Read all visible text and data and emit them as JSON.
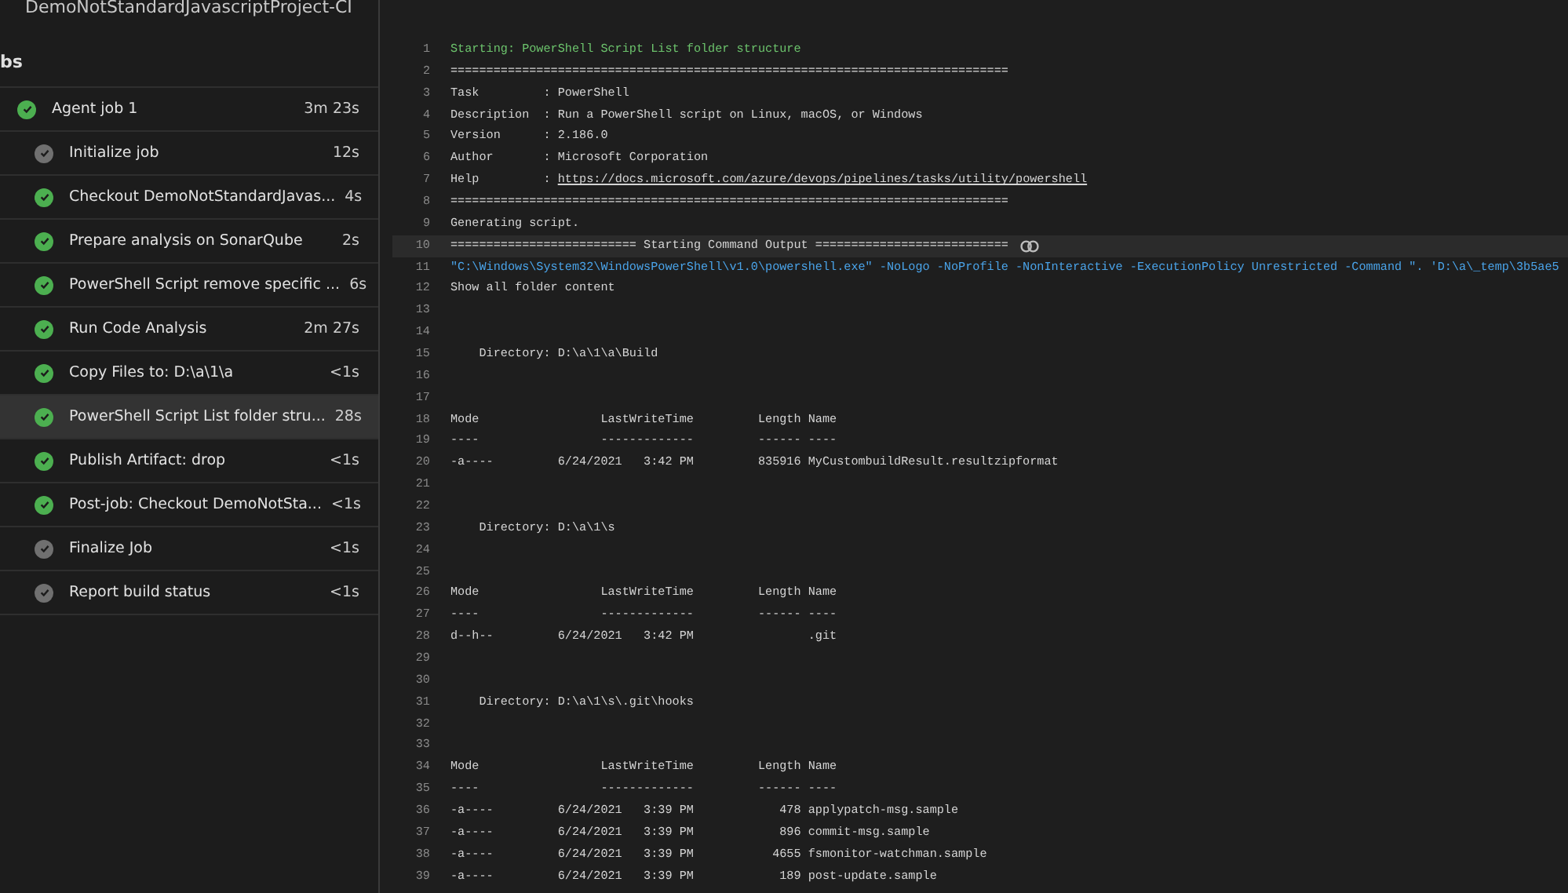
{
  "pipeline_title": "DemoNotStandardJavascriptProject-CI",
  "jobs_heading": "bs",
  "jobs": [
    {
      "label": "Agent job 1",
      "duration": "3m 23s",
      "color": "#4caf50",
      "selected": false,
      "children": [
        {
          "label": "Initialize job",
          "duration": "12s",
          "color": "#707070",
          "selected": false
        },
        {
          "label": "Checkout DemoNotStandardJavas...",
          "duration": "4s",
          "color": "#4caf50",
          "selected": false
        },
        {
          "label": "Prepare analysis on SonarQube",
          "duration": "2s",
          "color": "#4caf50",
          "selected": false
        },
        {
          "label": "PowerShell Script remove specific ...",
          "duration": "6s",
          "color": "#4caf50",
          "selected": false
        },
        {
          "label": "Run Code Analysis",
          "duration": "2m 27s",
          "color": "#4caf50",
          "selected": false
        },
        {
          "label": "Copy Files to: D:\\a\\1\\a",
          "duration": "<1s",
          "color": "#4caf50",
          "selected": false
        },
        {
          "label": "PowerShell Script List folder stru...",
          "duration": "28s",
          "color": "#4caf50",
          "selected": true
        },
        {
          "label": "Publish Artifact: drop",
          "duration": "<1s",
          "color": "#4caf50",
          "selected": false
        },
        {
          "label": "Post-job: Checkout DemoNotSta...",
          "duration": "<1s",
          "color": "#4caf50",
          "selected": false
        },
        {
          "label": "Finalize Job",
          "duration": "<1s",
          "color": "#707070",
          "selected": false
        },
        {
          "label": "Report build status",
          "duration": "<1s",
          "color": "#707070",
          "selected": false
        }
      ]
    }
  ],
  "log_lines": [
    {
      "number": "1",
      "kind": "section",
      "text": "Starting: PowerShell Script List folder structure"
    },
    {
      "number": "2",
      "kind": "plain",
      "text": "=============================================================================="
    },
    {
      "number": "3",
      "kind": "plain",
      "text": "Task         : PowerShell"
    },
    {
      "number": "4",
      "kind": "plain",
      "text": "Description  : Run a PowerShell script on Linux, macOS, or Windows"
    },
    {
      "number": "5",
      "kind": "plain",
      "text": "Version      : 2.186.0"
    },
    {
      "number": "6",
      "kind": "plain",
      "text": "Author       : Microsoft Corporation"
    },
    {
      "number": "7",
      "kind": "link",
      "text": "Help         : ",
      "link": "https://docs.microsoft.com/azure/devops/pipelines/tasks/utility/powershell"
    },
    {
      "number": "8",
      "kind": "plain",
      "text": "=============================================================================="
    },
    {
      "number": "9",
      "kind": "plain",
      "text": "Generating script."
    },
    {
      "number": "10",
      "kind": "marker",
      "text": "========================== Starting Command Output ==========================="
    },
    {
      "number": "11",
      "kind": "command",
      "text": "\"C:\\Windows\\System32\\WindowsPowerShell\\v1.0\\powershell.exe\" -NoLogo -NoProfile -NonInteractive -ExecutionPolicy Unrestricted -Command \". 'D:\\a\\_temp\\3b5ae5"
    },
    {
      "number": "12",
      "kind": "plain",
      "text": "Show all folder content"
    },
    {
      "number": "13",
      "kind": "plain"
    },
    {
      "number": "14",
      "kind": "plain"
    },
    {
      "number": "15",
      "kind": "plain",
      "text": "    Directory: D:\\a\\1\\a\\Build"
    },
    {
      "number": "16",
      "kind": "plain"
    },
    {
      "number": "17",
      "kind": "plain"
    },
    {
      "number": "18",
      "kind": "plain",
      "text": "Mode                 LastWriteTime         Length Name"
    },
    {
      "number": "19",
      "kind": "plain",
      "text": "----                 -------------         ------ ----"
    },
    {
      "number": "20",
      "kind": "plain",
      "text": "-a----         6/24/2021   3:42 PM         835916 MyCustombuildResult.resultzipformat"
    },
    {
      "number": "21",
      "kind": "plain"
    },
    {
      "number": "22",
      "kind": "plain"
    },
    {
      "number": "23",
      "kind": "plain",
      "text": "    Directory: D:\\a\\1\\s"
    },
    {
      "number": "24",
      "kind": "plain"
    },
    {
      "number": "25",
      "kind": "plain"
    },
    {
      "number": "26",
      "kind": "plain",
      "text": "Mode                 LastWriteTime         Length Name"
    },
    {
      "number": "27",
      "kind": "plain",
      "text": "----                 -------------         ------ ----"
    },
    {
      "number": "28",
      "kind": "plain",
      "text": "d--h--         6/24/2021   3:42 PM                .git"
    },
    {
      "number": "29",
      "kind": "plain"
    },
    {
      "number": "30",
      "kind": "plain"
    },
    {
      "number": "31",
      "kind": "plain",
      "text": "    Directory: D:\\a\\1\\s\\.git\\hooks"
    },
    {
      "number": "32",
      "kind": "plain"
    },
    {
      "number": "33",
      "kind": "plain"
    },
    {
      "number": "34",
      "kind": "plain",
      "text": "Mode                 LastWriteTime         Length Name"
    },
    {
      "number": "35",
      "kind": "plain",
      "text": "----                 -------------         ------ ----"
    },
    {
      "number": "36",
      "kind": "plain",
      "text": "-a----         6/24/2021   3:39 PM            478 applypatch-msg.sample"
    },
    {
      "number": "37",
      "kind": "plain",
      "text": "-a----         6/24/2021   3:39 PM            896 commit-msg.sample"
    },
    {
      "number": "38",
      "kind": "plain",
      "text": "-a----         6/24/2021   3:39 PM           4655 fsmonitor-watchman.sample"
    },
    {
      "number": "39",
      "kind": "plain",
      "text": "-a----         6/24/2021   3:39 PM            189 post-update.sample"
    }
  ]
}
